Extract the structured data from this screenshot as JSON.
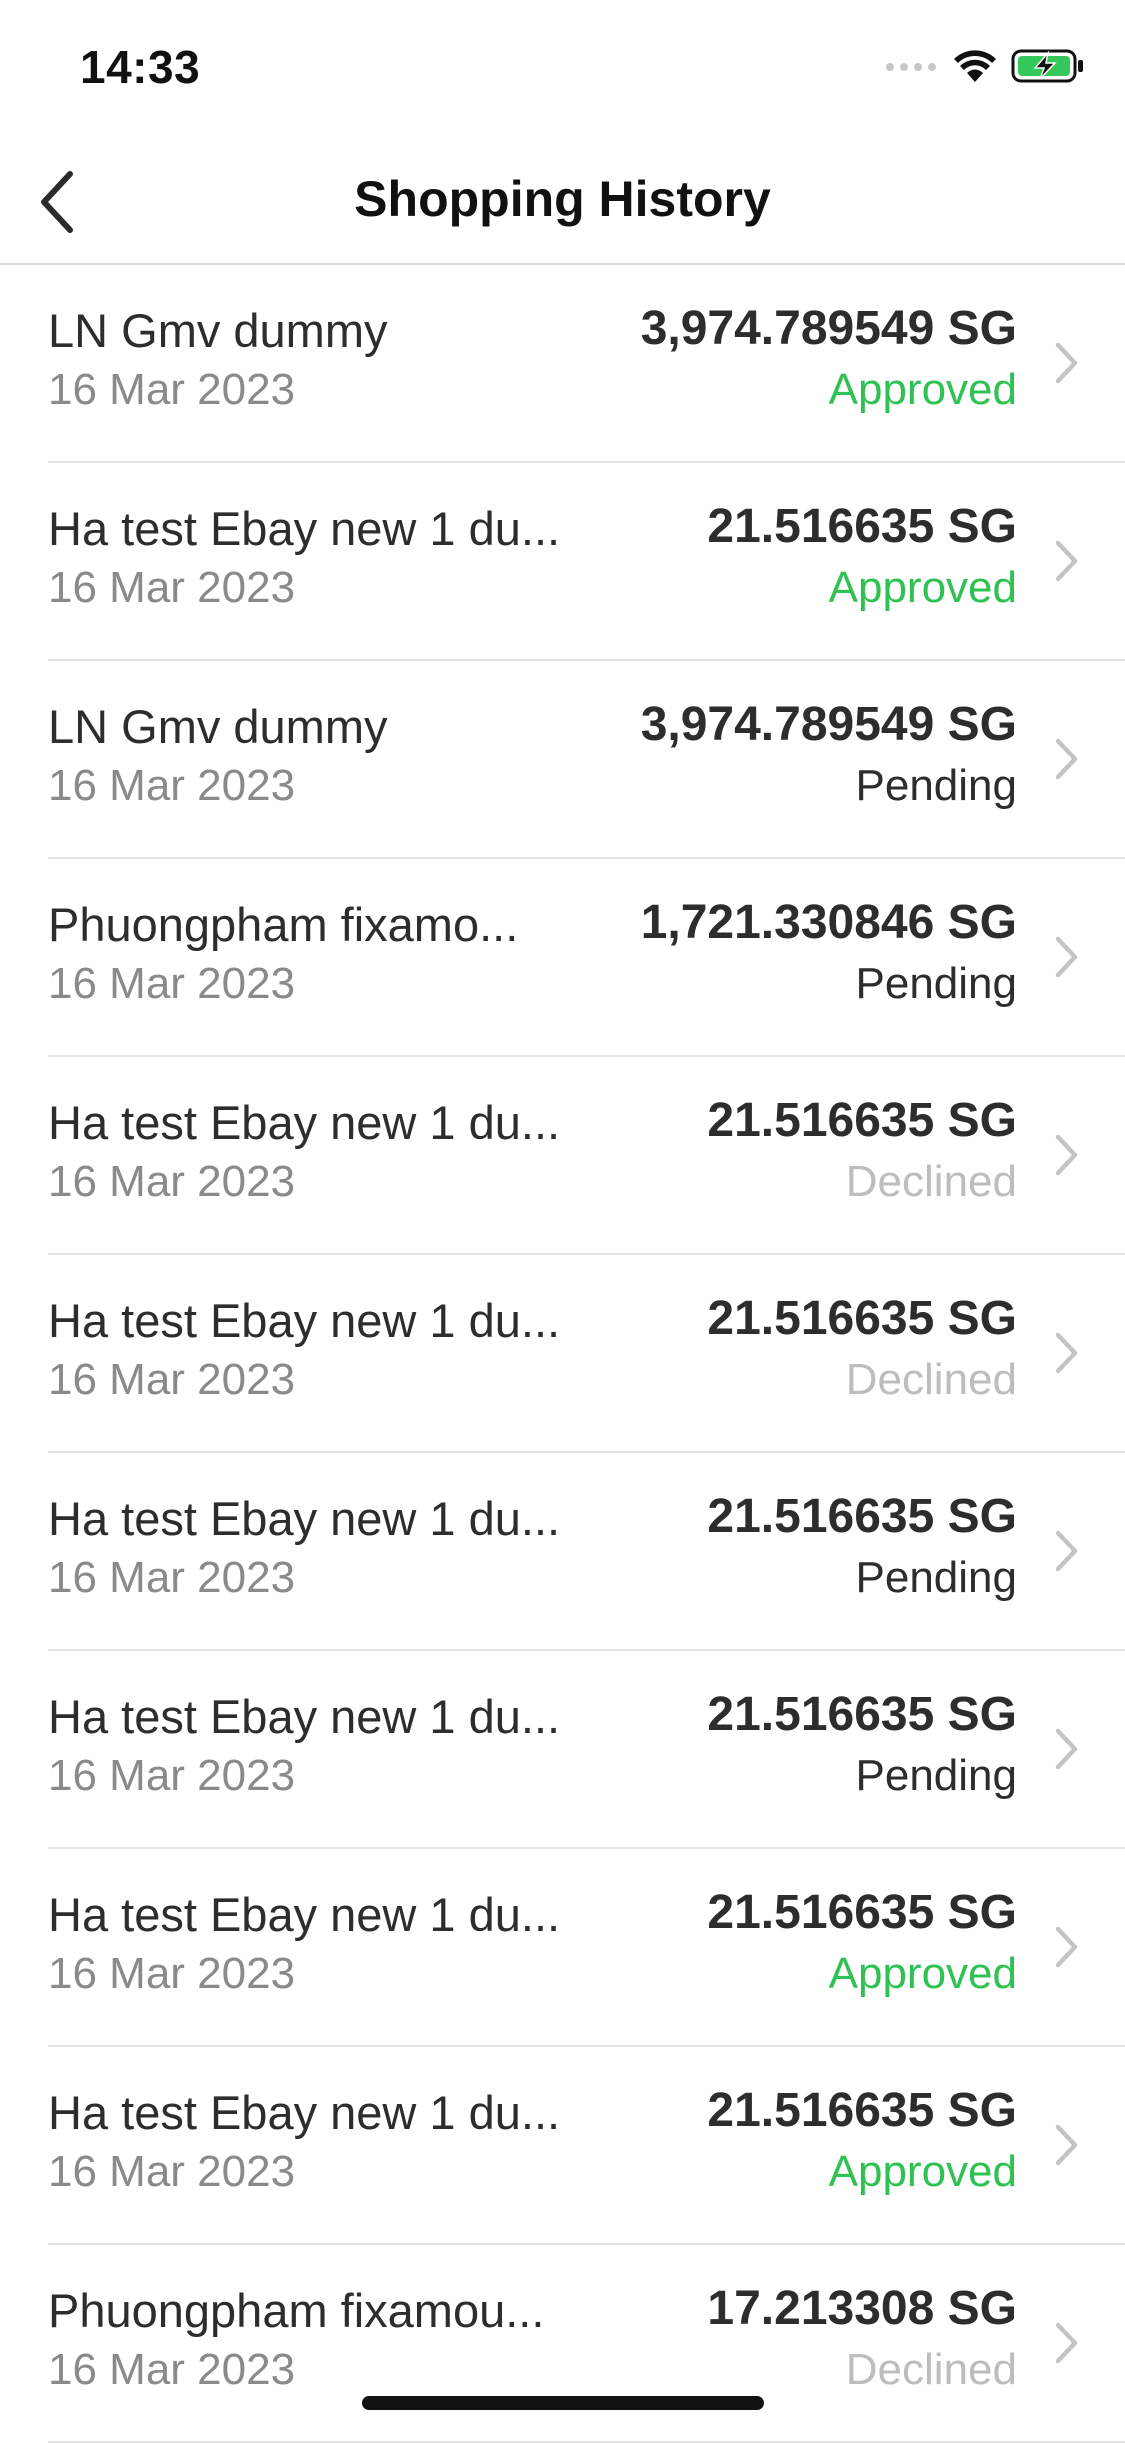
{
  "status_bar": {
    "time": "14:33",
    "icons": [
      "signal-icon",
      "wifi-icon",
      "battery-charging-icon"
    ]
  },
  "header": {
    "title": "Shopping History",
    "back_icon": "chevron-left-icon"
  },
  "colors": {
    "approved": "#2fc152",
    "pending": "#2d2d2d",
    "declined": "#bdbdbd",
    "battery": "#34c759"
  },
  "transactions": [
    {
      "name": "LN Gmv dummy",
      "date": "16 Mar 2023",
      "amount": "3,974.789549 SG",
      "status": "Approved"
    },
    {
      "name": "Ha test Ebay new 1 du...",
      "date": "16 Mar 2023",
      "amount": "21.516635 SG",
      "status": "Approved"
    },
    {
      "name": "LN Gmv dummy",
      "date": "16 Mar 2023",
      "amount": "3,974.789549 SG",
      "status": "Pending"
    },
    {
      "name": "Phuongpham fixamo...",
      "date": "16 Mar 2023",
      "amount": "1,721.330846 SG",
      "status": "Pending"
    },
    {
      "name": "Ha test Ebay new 1 du...",
      "date": "16 Mar 2023",
      "amount": "21.516635 SG",
      "status": "Declined"
    },
    {
      "name": "Ha test Ebay new 1 du...",
      "date": "16 Mar 2023",
      "amount": "21.516635 SG",
      "status": "Declined"
    },
    {
      "name": "Ha test Ebay new 1 du...",
      "date": "16 Mar 2023",
      "amount": "21.516635 SG",
      "status": "Pending"
    },
    {
      "name": "Ha test Ebay new 1 du...",
      "date": "16 Mar 2023",
      "amount": "21.516635 SG",
      "status": "Pending"
    },
    {
      "name": "Ha test Ebay new 1 du...",
      "date": "16 Mar 2023",
      "amount": "21.516635 SG",
      "status": "Approved"
    },
    {
      "name": "Ha test Ebay new 1 du...",
      "date": "16 Mar 2023",
      "amount": "21.516635 SG",
      "status": "Approved"
    },
    {
      "name": "Phuongpham fixamou...",
      "date": "16 Mar 2023",
      "amount": "17.213308 SG",
      "status": "Declined"
    }
  ]
}
